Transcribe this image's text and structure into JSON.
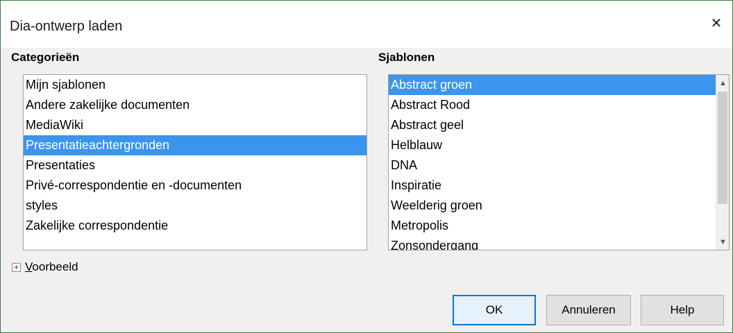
{
  "dialog": {
    "title": "Dia-ontwerp laden",
    "close_glyph": "✕"
  },
  "categories": {
    "label": "Categorieën",
    "selected_index": 3,
    "items": [
      {
        "label": "Mijn sjablonen"
      },
      {
        "label": "Andere zakelijke documenten"
      },
      {
        "label": "MediaWiki"
      },
      {
        "label": "Presentatieachtergronden"
      },
      {
        "label": "Presentaties"
      },
      {
        "label": "Privé-correspondentie en -documenten"
      },
      {
        "label": "styles"
      },
      {
        "label": "Zakelijke correspondentie"
      }
    ]
  },
  "templates": {
    "label": "Sjablonen",
    "selected_index": 0,
    "items": [
      {
        "label": "Abstract groen"
      },
      {
        "label": "Abstract Rood"
      },
      {
        "label": "Abstract geel"
      },
      {
        "label": "Helblauw"
      },
      {
        "label": "DNA"
      },
      {
        "label": "Inspiratie"
      },
      {
        "label": "Weelderig groen"
      },
      {
        "label": "Metropolis"
      },
      {
        "label": "Zonsondergang"
      }
    ],
    "scroll_up_icon": "chevron-up-icon",
    "scroll_down_icon": "chevron-down-icon"
  },
  "preview": {
    "label": "Voorbeeld",
    "expand_glyph": "+"
  },
  "buttons": {
    "ok": "OK",
    "cancel": "Annuleren",
    "help": "Help"
  },
  "colors": {
    "selection": "#3a95ee",
    "window_border": "#3a7c3a",
    "default_button_border": "#0078d7"
  }
}
